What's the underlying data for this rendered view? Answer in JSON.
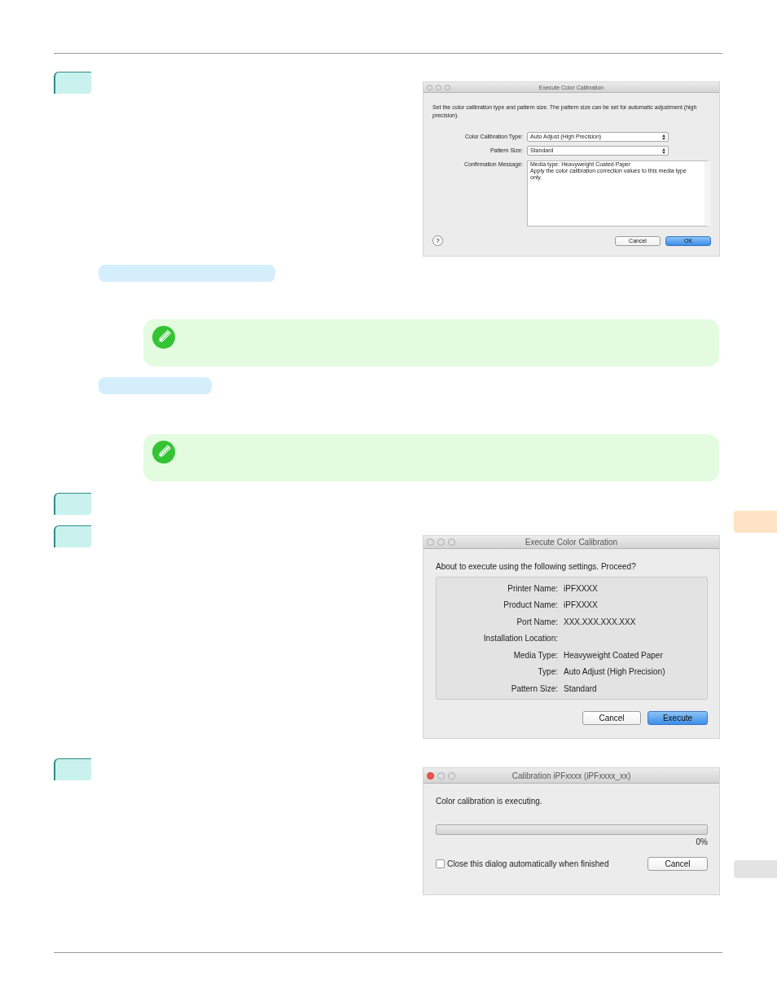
{
  "dialogs": [
    {
      "title": "Execute Color Calibration",
      "active": false,
      "description": "Set the color calibration type and pattern size. The pattern size can be set for automatic adjustment (high precision).",
      "fields": [
        {
          "kind": "select",
          "label": "Color Calibration Type:",
          "value": "Auto Adjust (High Precision)"
        },
        {
          "kind": "select",
          "label": "Pattern Size:",
          "value": "Standard"
        },
        {
          "kind": "textarea",
          "label": "Confirmation Message:",
          "lines": [
            "Media type: Heavyweight Coated Paper",
            "Apply the color calibration correction values to this media type only."
          ]
        }
      ],
      "help": "?",
      "buttons": [
        {
          "label": "Cancel",
          "default": false
        },
        {
          "label": "OK",
          "default": true
        }
      ]
    },
    {
      "title": "Execute Color Calibration",
      "active": false,
      "message": "About to execute using the following settings. Proceed?",
      "settings": [
        {
          "label": "Printer Name:",
          "value": "iPFXXXX"
        },
        {
          "label": "Product Name:",
          "value": "iPFXXXX"
        },
        {
          "label": "Port Name:",
          "value": "XXX.XXX.XXX.XXX"
        },
        {
          "label": "Installation Location:"
        },
        {
          "label": "Media Type:",
          "value": "Heavyweight Coated Paper"
        },
        {
          "label": "Type:",
          "value": "Auto Adjust (High Precision)"
        },
        {
          "label": "Pattern Size:",
          "value": "Standard"
        }
      ],
      "buttons": [
        {
          "label": "Cancel",
          "default": false
        },
        {
          "label": "Execute",
          "default": true
        }
      ]
    },
    {
      "title": "Calibration iPFxxxx (iPFxxxx_xx)",
      "active": true,
      "message": "Color calibration is executing.",
      "progress": {
        "level": 0,
        "reading": "0%"
      },
      "checkbox": {
        "label": "Close this dialog automatically when finished",
        "checked": false
      },
      "buttons": [
        {
          "label": "Cancel",
          "default": false
        }
      ]
    }
  ],
  "side_tabs": [
    {
      "selected": true
    },
    {
      "selected": false
    }
  ]
}
